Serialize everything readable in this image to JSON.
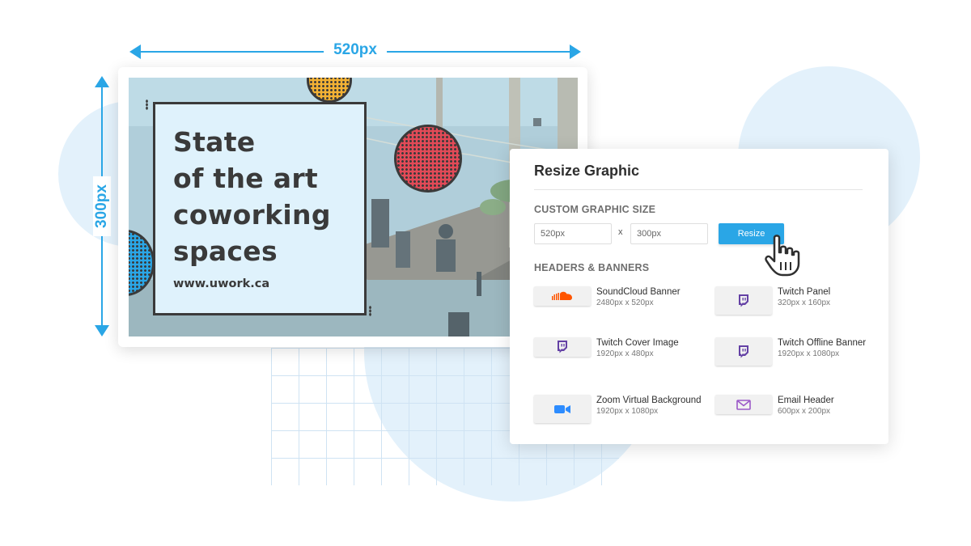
{
  "dimensions": {
    "width_label": "520px",
    "height_label": "300px"
  },
  "graphic": {
    "headline_lines": [
      "State",
      "of the art",
      "coworking",
      "spaces"
    ],
    "url": "www.uwork.ca"
  },
  "colors": {
    "accent": "#2aa6e6",
    "dot_yellow": "#f2b134",
    "dot_red": "#e24a57",
    "soundcloud": "#ff5500",
    "twitch": "#6441a5",
    "zoom": "#2d8cff",
    "email": "#9b59c8"
  },
  "resize_panel": {
    "title": "Resize Graphic",
    "custom_label": "CUSTOM GRAPHIC SIZE",
    "width_value": "520px",
    "height_value": "300px",
    "times": "x",
    "resize_button": "Resize",
    "headers_label": "HEADERS & BANNERS",
    "presets": [
      {
        "name": "SoundCloud Banner",
        "dims": "2480px x 520px",
        "icon": "soundcloud-icon"
      },
      {
        "name": "Twitch Panel",
        "dims": "320px x 160px",
        "icon": "twitch-icon"
      },
      {
        "name": "Twitch Cover Image",
        "dims": "1920px x 480px",
        "icon": "twitch-icon"
      },
      {
        "name": "Twitch Offline Banner",
        "dims": "1920px x 1080px",
        "icon": "twitch-icon"
      },
      {
        "name": "Zoom Virtual Background",
        "dims": "1920px x 1080px",
        "icon": "zoom-video-icon"
      },
      {
        "name": "Email Header",
        "dims": "600px x 200px",
        "icon": "email-icon"
      }
    ]
  }
}
